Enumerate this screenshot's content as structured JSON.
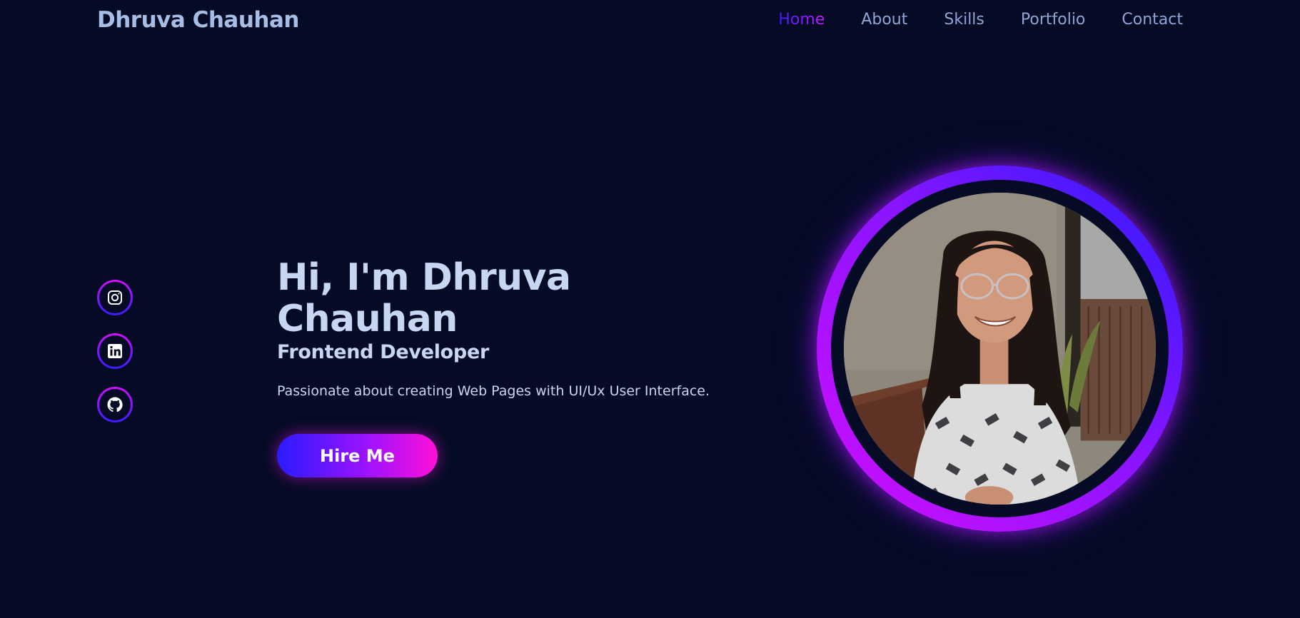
{
  "header": {
    "logo": "Dhruva Chauhan",
    "nav": [
      {
        "label": "Home",
        "active": true
      },
      {
        "label": "About",
        "active": false
      },
      {
        "label": "Skills",
        "active": false
      },
      {
        "label": "Portfolio",
        "active": false
      },
      {
        "label": "Contact",
        "active": false
      }
    ]
  },
  "socials": [
    {
      "icon": "instagram-icon"
    },
    {
      "icon": "linkedin-icon"
    },
    {
      "icon": "github-icon"
    }
  ],
  "hero": {
    "greeting": "Hi, I'm Dhruva Chauhan",
    "role": "Frontend Developer",
    "tagline": "Passionate about creating Web Pages with UI/Ux User Interface.",
    "cta_label": "Hire Me"
  },
  "portrait": {
    "subject": "profile-photo"
  },
  "colors": {
    "background": "#050b24",
    "text": "#c7d6f2",
    "accent_start": "#2a1bff",
    "accent_end": "#ff0fd8"
  }
}
